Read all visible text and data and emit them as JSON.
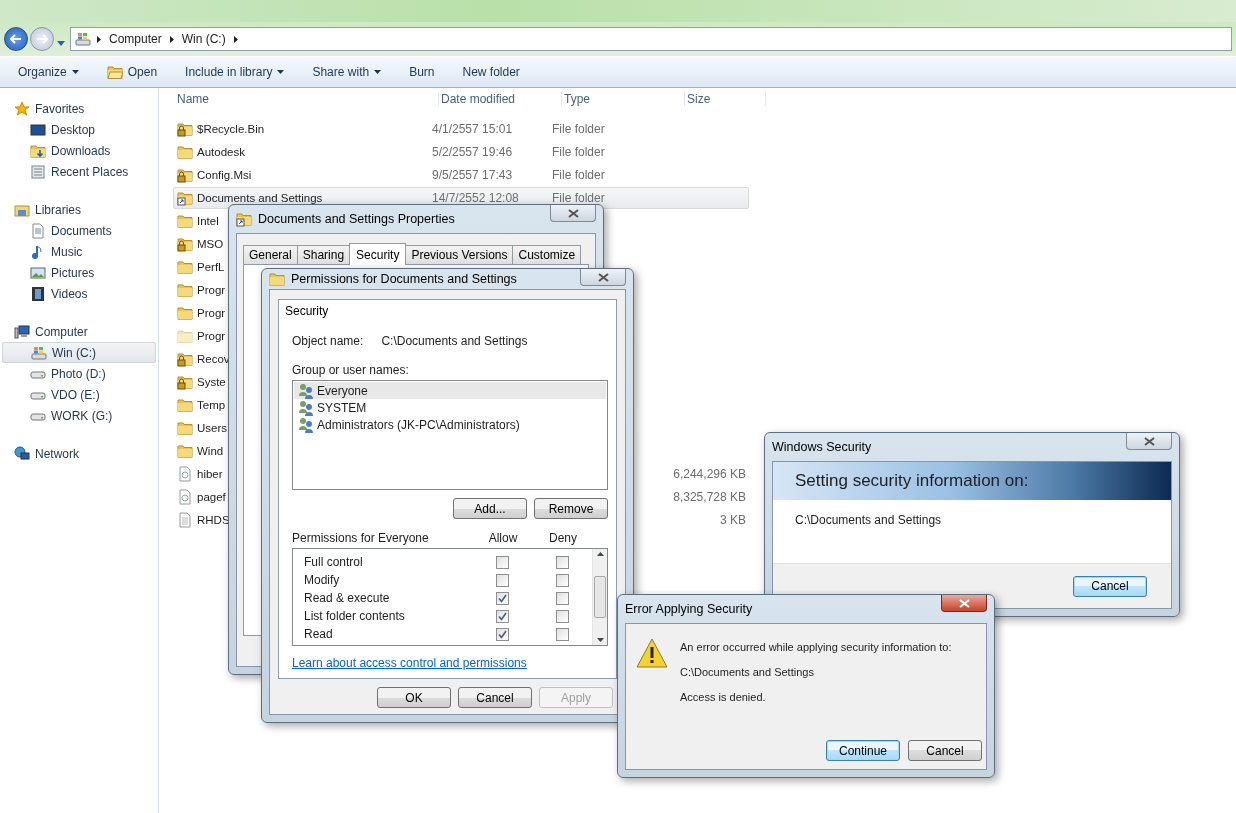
{
  "explorer": {
    "breadcrumb": [
      "Computer",
      "Win (C:)"
    ],
    "toolbar": [
      {
        "label": "Organize",
        "dropdown": true
      },
      {
        "label": "Open",
        "dropdown": false
      },
      {
        "label": "Include in library",
        "dropdown": true
      },
      {
        "label": "Share with",
        "dropdown": true
      },
      {
        "label": "Burn",
        "dropdown": false
      },
      {
        "label": "New folder",
        "dropdown": false
      }
    ],
    "sidebar": [
      {
        "label": "Favorites",
        "children": [
          {
            "label": "Desktop",
            "selected": false
          },
          {
            "label": "Downloads",
            "selected": false
          },
          {
            "label": "Recent Places",
            "selected": false
          }
        ]
      },
      {
        "label": "Libraries",
        "children": [
          {
            "label": "Documents",
            "selected": false
          },
          {
            "label": "Music",
            "selected": false
          },
          {
            "label": "Pictures",
            "selected": false
          },
          {
            "label": "Videos",
            "selected": false
          }
        ]
      },
      {
        "label": "Computer",
        "children": [
          {
            "label": "Win (C:)",
            "selected": true
          },
          {
            "label": "Photo (D:)",
            "selected": false
          },
          {
            "label": "VDO (E:)",
            "selected": false
          },
          {
            "label": "WORK (G:)",
            "selected": false
          }
        ]
      },
      {
        "label": "Network"
      }
    ],
    "columns": [
      "Name",
      "Date modified",
      "Type",
      "Size"
    ],
    "files": [
      {
        "name": "$Recycle.Bin",
        "kind": "locked",
        "date": "4/1/2557 15:01",
        "type": "File folder",
        "selected": false
      },
      {
        "name": "Autodesk",
        "kind": "folder",
        "date": "5/2/2557 19:46",
        "type": "File folder",
        "selected": false
      },
      {
        "name": "Config.Msi",
        "kind": "locked",
        "date": "9/5/2557 17:43",
        "type": "File folder",
        "selected": false
      },
      {
        "name": "Documents and Settings",
        "kind": "shortcut",
        "date": "14/7/2552 12:08",
        "type": "File folder",
        "selected": true
      },
      {
        "name": "Intel",
        "kind": "folder",
        "selected": false
      },
      {
        "name": "MSO",
        "kind": "locked",
        "selected": false
      },
      {
        "name": "PerfL",
        "kind": "folder",
        "selected": false
      },
      {
        "name": "Progr",
        "kind": "folder",
        "selected": false
      },
      {
        "name": "Progr",
        "kind": "folder",
        "selected": false
      },
      {
        "name": "Progr",
        "kind": "hidden",
        "selected": false
      },
      {
        "name": "Recov",
        "kind": "locked",
        "selected": false
      },
      {
        "name": "Syste",
        "kind": "locked",
        "selected": false
      },
      {
        "name": "Temp",
        "kind": "folder",
        "selected": false
      },
      {
        "name": "Users",
        "kind": "folder",
        "selected": false
      },
      {
        "name": "Wind",
        "kind": "folder",
        "selected": false
      },
      {
        "name": "hiber",
        "kind": "system",
        "size": "6,244,296 KB",
        "selected": false
      },
      {
        "name": "pagef",
        "kind": "system",
        "size": "8,325,728 KB",
        "selected": false
      },
      {
        "name": "RHDS",
        "kind": "text",
        "size": "3 KB",
        "selected": false
      }
    ]
  },
  "properties": {
    "title": "Documents and Settings Properties",
    "tabs": [
      {
        "label": "General",
        "selected": false
      },
      {
        "label": "Sharing",
        "selected": false
      },
      {
        "label": "Security",
        "selected": true
      },
      {
        "label": "Previous Versions",
        "selected": false
      },
      {
        "label": "Customize",
        "selected": false
      }
    ]
  },
  "permissions": {
    "title": "Permissions for Documents and Settings",
    "tab": "Security",
    "object_label": "Object name:",
    "object_value": "C:\\Documents and Settings",
    "group_label": "Group or user names:",
    "users": [
      {
        "name": "Everyone",
        "selected": true
      },
      {
        "name": "SYSTEM",
        "selected": false
      },
      {
        "name": "Administrators (JK-PC\\Administrators)",
        "selected": false
      }
    ],
    "add_button": "Add...",
    "remove_button": "Remove",
    "permissions_label": "Permissions for Everyone",
    "allow_label": "Allow",
    "deny_label": "Deny",
    "rights": [
      {
        "name": "Full control",
        "allow": false,
        "deny": false
      },
      {
        "name": "Modify",
        "allow": false,
        "deny": false
      },
      {
        "name": "Read & execute",
        "allow": true,
        "deny": false
      },
      {
        "name": "List folder contents",
        "allow": true,
        "deny": false
      },
      {
        "name": "Read",
        "allow": true,
        "deny": false
      }
    ],
    "link": "Learn about access control and permissions",
    "buttons": [
      {
        "label": "OK",
        "disabled": false
      },
      {
        "label": "Cancel",
        "disabled": false
      },
      {
        "label": "Apply",
        "disabled": true
      }
    ]
  },
  "windows_security": {
    "title": "Windows Security",
    "heading": "Setting security information on:",
    "path": "C:\\Documents and Settings",
    "button": {
      "label": "Cancel",
      "default": true
    }
  },
  "error": {
    "title": "Error Applying Security",
    "message": "An error occurred while applying security information to:",
    "path": "C:\\Documents and Settings",
    "detail": "Access is denied.",
    "buttons": [
      {
        "label": "Continue",
        "default": true
      },
      {
        "label": "Cancel",
        "default": false
      }
    ]
  }
}
